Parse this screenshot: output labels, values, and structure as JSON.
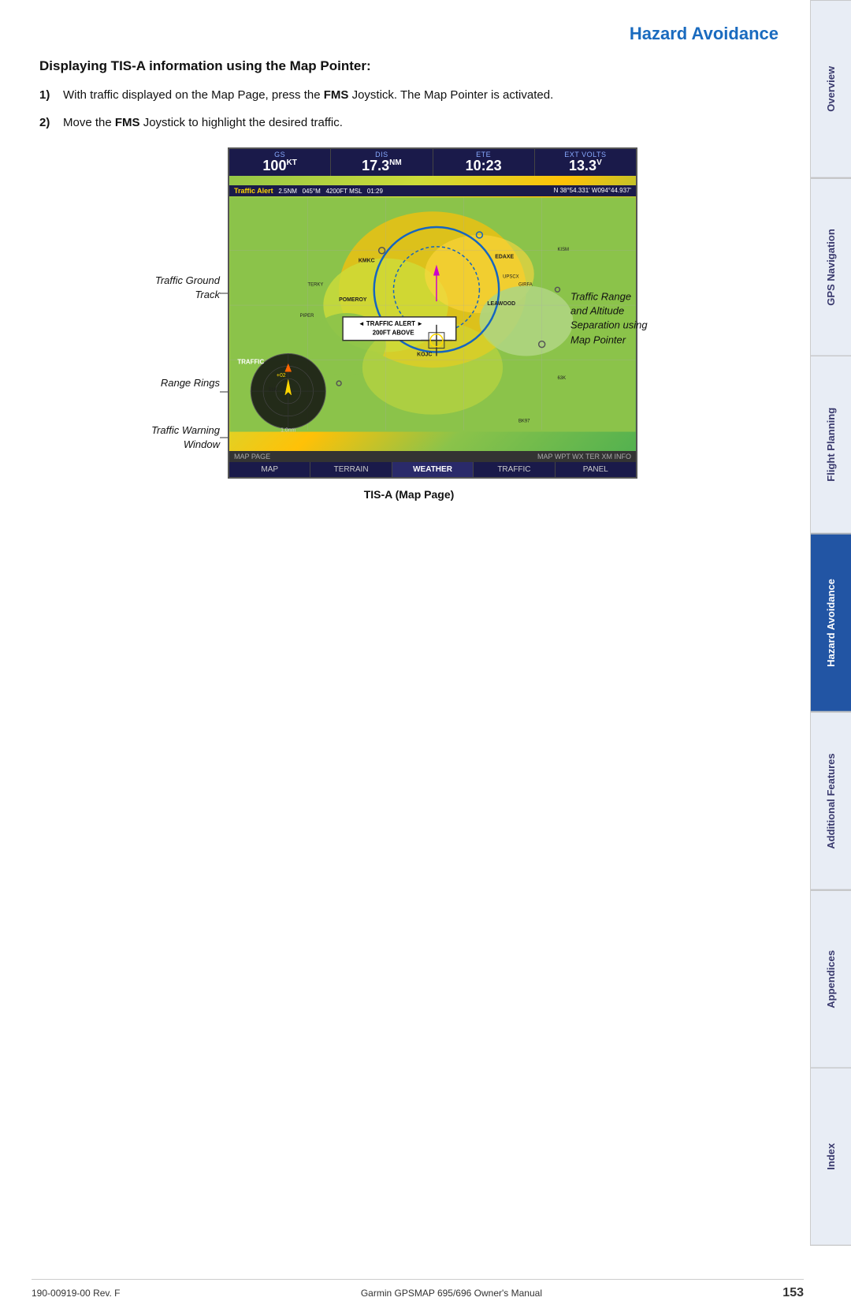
{
  "header": {
    "title": "Hazard Avoidance"
  },
  "sidebar": {
    "tabs": [
      {
        "label": "Overview",
        "active": false
      },
      {
        "label": "GPS Navigation",
        "active": false
      },
      {
        "label": "Flight Planning",
        "active": false
      },
      {
        "label": "Hazard Avoidance",
        "active": true
      },
      {
        "label": "Additional Features",
        "active": false
      },
      {
        "label": "Appendices",
        "active": false
      },
      {
        "label": "Index",
        "active": false
      }
    ]
  },
  "section": {
    "heading": "Displaying TIS-A information using the Map Pointer:"
  },
  "instructions": [
    {
      "num": "1)",
      "text": "With traffic displayed on the Map Page, press the FMS Joystick.  The Map Pointer is activated."
    },
    {
      "num": "2)",
      "text": "Move the FMS Joystick to highlight the desired traffic."
    }
  ],
  "map": {
    "header_cells": [
      {
        "label": "GS",
        "value": "100",
        "unit": "KT"
      },
      {
        "label": "DIS",
        "value": "17.3",
        "unit": "NM"
      },
      {
        "label": "ETE",
        "value": "10:23",
        "unit": ""
      },
      {
        "label": "EXT VOLTS",
        "value": "13.3",
        "unit": "V"
      }
    ],
    "traffic_alert": {
      "label": "Traffic Alert",
      "details": "2.5NM   045°M   4200FT MSL   01:29   N 38°54.331'  W094°44.937'"
    },
    "traffic_popup": {
      "left_arrow": "◄",
      "line1": "Traffic Alert",
      "line2": "200FT Above",
      "right_arrow": "►"
    },
    "footer_row1": "MAP PAGE",
    "footer_row1_right": "MAP WPT WX TER XM INFO",
    "footer_tabs": [
      {
        "label": "MAP",
        "active": false
      },
      {
        "label": "TERRAIN",
        "active": false
      },
      {
        "label": "WEATHER",
        "active": true
      },
      {
        "label": "TRAFFIC",
        "active": false
      },
      {
        "label": "PANEL",
        "active": false
      }
    ],
    "radar_label": "TRAFFIC"
  },
  "annotations": {
    "traffic_ground_track": "Traffic Ground\nTrack",
    "range_rings": "Range Rings",
    "traffic_warning_window": "Traffic Warning\nWindow",
    "traffic_range_altitude": "Traffic Range\nand Altitude\nSeparation using\nMap Pointer"
  },
  "caption": "TIS-A (Map Page)",
  "footer": {
    "left": "190-00919-00 Rev. F",
    "center": "Garmin GPSMAP 695/696 Owner's Manual",
    "page": "153"
  }
}
